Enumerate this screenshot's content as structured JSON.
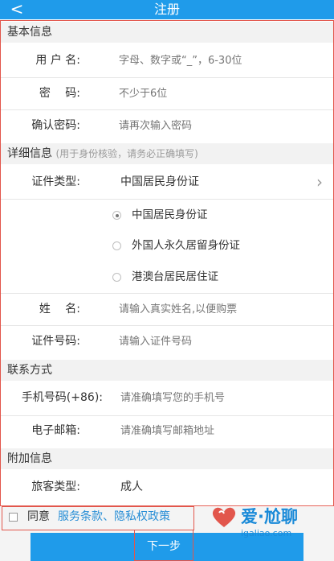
{
  "header": {
    "back_icon": "chevron-left-icon",
    "back_glyph": "<",
    "title": "注册"
  },
  "basic": {
    "title": "基本信息",
    "username": {
      "label": "用 户 名:",
      "placeholder": "字母、数字或“_”，6-30位"
    },
    "password": {
      "label": "密　 码:",
      "placeholder": "不少于6位"
    },
    "confirm": {
      "label": "确认密码:",
      "placeholder": "请再次输入密码"
    }
  },
  "detail": {
    "title": "详细信息",
    "hint": "(用于身份核验，请务必正确填写)",
    "id_type": {
      "label": "证件类型:",
      "value": "中国居民身份证",
      "chevron": "›"
    },
    "id_options": [
      {
        "label": "中国居民身份证",
        "checked": true
      },
      {
        "label": "外国人永久居留身份证",
        "checked": false
      },
      {
        "label": "港澳台居民居住证",
        "checked": false
      }
    ],
    "name": {
      "label": "姓　 名:",
      "placeholder": "请输入真实姓名,以便购票"
    },
    "id_number": {
      "label": "证件号码:",
      "placeholder": "请输入证件号码"
    }
  },
  "contact": {
    "title": "联系方式",
    "phone": {
      "label": "手机号码(+86):",
      "placeholder": "请准确填写您的手机号"
    },
    "email": {
      "label": "电子邮箱:",
      "placeholder": "请准确填写邮箱地址"
    }
  },
  "extra": {
    "title": "附加信息",
    "passenger_type": {
      "label": "旅客类型:",
      "value": "成人"
    }
  },
  "footer": {
    "agree_text": "同意",
    "terms_link": "服务条款、隐私权政策",
    "next_button": "下一步"
  },
  "watermark": {
    "brand": "爱·尬聊",
    "domain": "igaliao.com"
  },
  "colors": {
    "primary": "#1f9bea",
    "highlight": "#e2564c",
    "link": "#2a8fd6"
  }
}
